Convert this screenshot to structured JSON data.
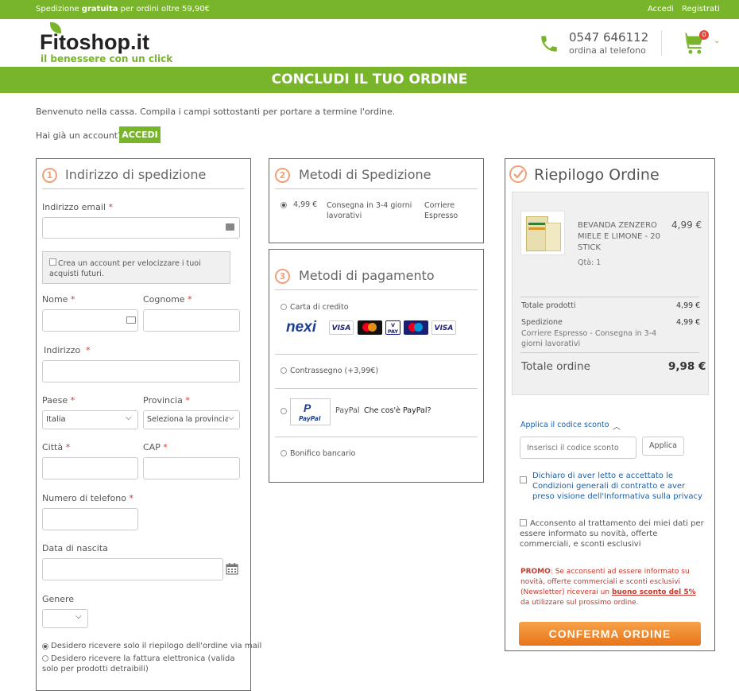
{
  "topbar": {
    "shipping_pre": "Spedizione ",
    "shipping_bold": "gratuita",
    "shipping_post": " per ordini oltre 59,90€",
    "login": "Accedi",
    "register": "Registrati"
  },
  "header": {
    "logo": "Fitoshop.it",
    "tagline": "il benessere con un click",
    "phone": "0547 646112",
    "phone_sub": "ordina al telefono",
    "cart_count": "0"
  },
  "banner": "CONCLUDI IL TUO ORDINE",
  "intro": "Benvenuto nella cassa. Compila i campi sottostanti per portare a termine l'ordine.",
  "account": {
    "question": "Hai già un account?",
    "button": "ACCEDI"
  },
  "shipping_address": {
    "number": "1",
    "title": "Indirizzo di spedizione",
    "email_label": "Indirizzo email",
    "create_account": "Crea un account per velocizzare i tuoi acquisti futuri.",
    "nome_label": "Nome",
    "cognome_label": "Cognome",
    "indirizzo_label": "Indirizzo",
    "paese_label": "Paese",
    "paese_value": "Italia",
    "provincia_label": "Provincia",
    "provincia_value": "Seleziona la provincia",
    "citta_label": "Città",
    "cap_label": "CAP",
    "telefono_label": "Numero di telefono",
    "nascita_label": "Data di nascita",
    "genere_label": "Genere",
    "genere_value": "",
    "opt_riepilogo": "Desidero ricevere solo il riepilogo dell'ordine via mail",
    "opt_fattura": "Desidero ricevere la fattura elettronica (valida solo per prodotti detraibili)",
    "req": "*"
  },
  "shipping_methods": {
    "number": "2",
    "title": "Metodi di Spedizione",
    "price": "4,99 €",
    "desc": "Consegna in 3-4 giorni lavorativi",
    "carrier": "Corriere Espresso"
  },
  "payment": {
    "number": "3",
    "title": "Metodi di pagamento",
    "card": "Carta di credito",
    "cod": "Contrassegno (+3,99€)",
    "paypal": "PayPal",
    "paypal_link": "Che cos'è PayPal?",
    "bank": "Bonifico bancario",
    "logos": {
      "nexi": "nexi",
      "visa": "VISA",
      "vpay": "V PAY",
      "paypal_logo": "PayPal"
    }
  },
  "summary": {
    "title": "Riepilogo Ordine",
    "product_name": "BEVANDA ZENZERO MIELE E LIMONE - 20 STICK",
    "product_price": "4,99 €",
    "qty": "Qtà: 1",
    "subtotal_label": "Totale prodotti",
    "subtotal": "4,99 €",
    "ship_label": "Spedizione",
    "ship_desc": "Corriere Espresso - Consegna in 3-4 giorni lavorativi",
    "ship_price": "4,99 €",
    "total_label": "Totale ordine",
    "total": "9,98 €",
    "coupon_toggle": "Applica il codice sconto",
    "coupon_placeholder": "Inserisci il codice sconto",
    "coupon_apply": "Applica",
    "terms": "Dichiaro di aver letto e accettato le Condizioni generali di contratto e aver preso visione dell'Informativa sulla privacy",
    "marketing": "Acconsento al trattamento dei miei dati per essere informato su novità, offerte commerciali, e sconti esclusivi",
    "promo_label": "PROMO",
    "promo_text": ": Se acconsenti ad essere informato su novità, offerte commerciali e sconti esclusivi (Newsletter) riceverai un ",
    "promo_link": "buono sconto del 5%",
    "promo_end": " da utilizzare sul prossimo ordine.",
    "confirm": "CONFERMA ORDINE"
  }
}
